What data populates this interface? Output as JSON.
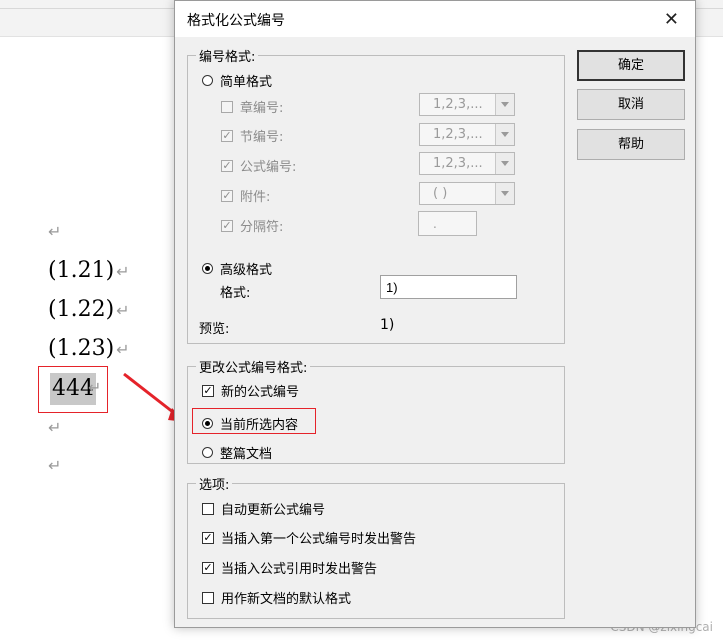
{
  "document": {
    "paragraph_mark": "↵",
    "equations": [
      "(1.21)",
      "(1.22)",
      "(1.23)"
    ],
    "selected_text": "444",
    "watermark": "CSDN @zixingcai"
  },
  "dialog": {
    "title": "格式化公式编号",
    "buttons": {
      "ok": "确定",
      "cancel": "取消",
      "help": "帮助"
    },
    "numbering_format": {
      "legend": "编号格式:",
      "simple_format": "简单格式",
      "chapter_number": {
        "label": "章编号:",
        "value": "1,2,3,...",
        "checked": false
      },
      "section_number": {
        "label": "节编号:",
        "value": "1,2,3,...",
        "checked": true
      },
      "equation_number": {
        "label": "公式编号:",
        "value": "1,2,3,...",
        "checked": true
      },
      "attachment": {
        "label": "附件:",
        "value": "( )",
        "checked": true
      },
      "separator": {
        "label": "分隔符:",
        "value": ".",
        "checked": true
      },
      "advanced_format": "高级格式",
      "format_label": "格式:",
      "format_value": "1)",
      "preview_label": "预览:",
      "preview_value": "1)",
      "selected_mode": "advanced"
    },
    "change_format": {
      "legend": "更改公式编号格式:",
      "new_equation_numbers": "新的公式编号",
      "current_selection": "当前所选内容",
      "whole_document": "整篇文档",
      "selected_scope": "current_selection"
    },
    "options": {
      "legend": "选项:",
      "auto_update": {
        "label": "自动更新公式编号",
        "checked": false
      },
      "warn_first_insert": {
        "label": "当插入第一个公式编号时发出警告",
        "checked": true
      },
      "warn_reference_insert": {
        "label": "当插入公式引用时发出警告",
        "checked": true
      },
      "default_for_new": {
        "label": "用作新文档的默认格式",
        "checked": false
      }
    }
  },
  "colors": {
    "highlight_red": "#e5232a",
    "dialog_bg": "#f0f0f0"
  }
}
